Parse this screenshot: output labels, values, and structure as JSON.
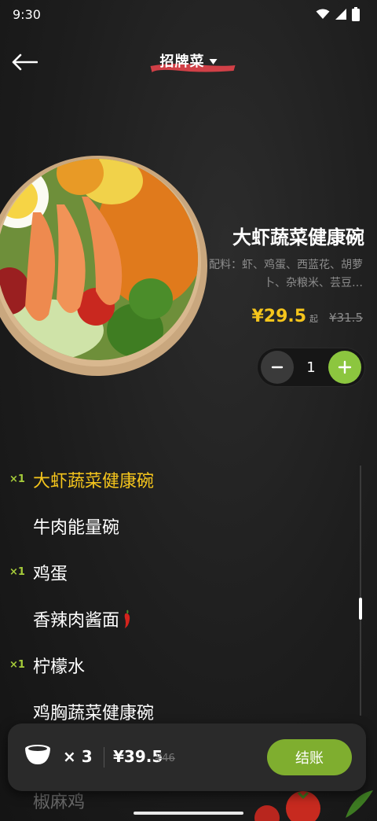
{
  "status_bar": {
    "time": "9:30",
    "icons": [
      "wifi-icon",
      "signal-icon",
      "battery-icon"
    ]
  },
  "header": {
    "title": "招牌菜",
    "back_icon": "back-arrow-icon",
    "dropdown_icon": "caret-down-icon"
  },
  "featured": {
    "name": "大虾蔬菜健康碗",
    "ingredients": "配料：虾、鸡蛋、西蓝花、胡萝卜、杂粮米、芸豆…",
    "price": "¥29.5",
    "price_suffix": "起",
    "original_price": "¥31.5",
    "quantity": "1",
    "colors": {
      "price": "#f5c51c",
      "plus": "#8cc63f"
    }
  },
  "menu": {
    "items": [
      {
        "label": "大虾蔬菜健康碗",
        "count": "×1",
        "active": true
      },
      {
        "label": "牛肉能量碗",
        "count": ""
      },
      {
        "label": "鸡蛋",
        "count": "×1"
      },
      {
        "label": "香辣肉酱面",
        "count": "",
        "spicy": true
      },
      {
        "label": "柠檬水",
        "count": "×1"
      },
      {
        "label": "鸡胸蔬菜健康碗",
        "count": ""
      }
    ],
    "partially_hidden": "椒麻鸡"
  },
  "cart": {
    "count": "× 3",
    "total": "¥39.5",
    "original_total": "¥46",
    "checkout_label": "结账",
    "colors": {
      "checkout": "#7fae2f",
      "active_item": "#f5c51c",
      "count_badge": "#a6cc3a"
    }
  }
}
